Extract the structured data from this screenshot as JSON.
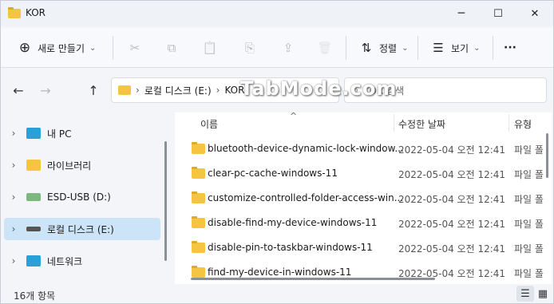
{
  "window": {
    "title": "KOR",
    "minimize": "─",
    "maximize": "☐",
    "close": "✕"
  },
  "toolbar": {
    "new_label": "새로 만들기",
    "new_icon": "⊕",
    "new_chevron": "⌄",
    "cut_icon": "✂",
    "copy_icon": "⧉",
    "paste_icon": "📋",
    "rename_icon": "⎘",
    "share_icon": "⇪",
    "delete_icon": "🗑",
    "sort_label": "정렬",
    "sort_icon": "⇅",
    "sort_chevron": "⌄",
    "view_label": "보기",
    "view_icon": "☰",
    "view_chevron": "⌄",
    "more_icon": "···"
  },
  "nav_buttons": {
    "back": "←",
    "forward": "→",
    "up": "↑"
  },
  "address": {
    "sep1": "›",
    "drive": "로컬 디스크 (E:)",
    "sep2": "›",
    "folder": "KOR",
    "chevron": "⌄"
  },
  "search": {
    "icon": "⌕",
    "placeholder": "KOR 검색"
  },
  "watermark": "TabMode.com",
  "sidebar": {
    "items": [
      {
        "label": "내 PC",
        "chevron": "›",
        "icon_color": "#2a9fd8"
      },
      {
        "label": "라이브러리",
        "chevron": "›",
        "icon_color": "#f5c542"
      },
      {
        "label": "ESD-USB (D:)",
        "chevron": "›",
        "icon_color": "#4caf50"
      },
      {
        "label": "로컬 디스크 (E:)",
        "chevron": "›",
        "icon_color": "#555555"
      },
      {
        "label": "네트워크",
        "chevron": "›",
        "icon_color": "#2a9fd8"
      }
    ]
  },
  "columns": {
    "name": "이름",
    "modified": "수정한 날짜",
    "type": "유형",
    "sort_arrow": "^"
  },
  "files": [
    {
      "name": "bluetooth-device-dynamic-lock-window...",
      "modified": "2022-05-04 오전 12:41",
      "type": "파일 폴"
    },
    {
      "name": "clear-pc-cache-windows-11",
      "modified": "2022-05-04 오전 12:41",
      "type": "파일 폴"
    },
    {
      "name": "customize-controlled-folder-access-win...",
      "modified": "2022-05-04 오전 12:41",
      "type": "파일 폴"
    },
    {
      "name": "disable-find-my-device-windows-11",
      "modified": "2022-05-04 오전 12:41",
      "type": "파일 폴"
    },
    {
      "name": "disable-pin-to-taskbar-windows-11",
      "modified": "2022-05-04 오전 12:41",
      "type": "파일 폴"
    },
    {
      "name": "find-my-device-in-windows-11",
      "modified": "2022-05-04 오전 12:41",
      "type": "파일 폴"
    }
  ],
  "status": {
    "count": "16개 항목",
    "details_icon": "☰",
    "tiles_icon": "▦"
  }
}
